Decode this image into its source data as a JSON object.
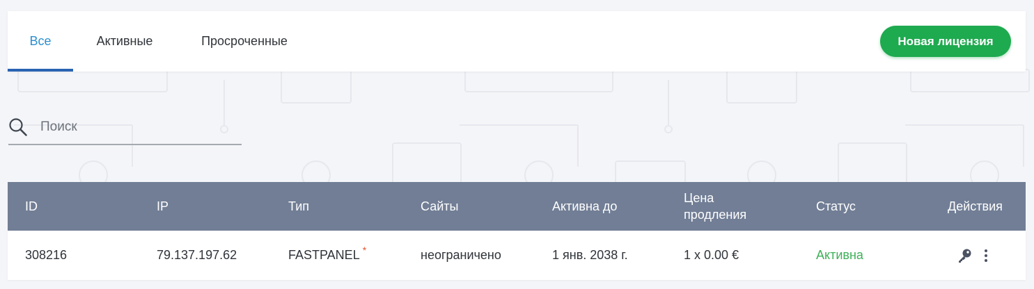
{
  "tabs": [
    {
      "label": "Все",
      "active": true
    },
    {
      "label": "Активные",
      "active": false
    },
    {
      "label": "Просроченные",
      "active": false
    }
  ],
  "new_license_button": "Новая лицензия",
  "search": {
    "placeholder": "Поиск",
    "value": ""
  },
  "table": {
    "headers": {
      "id": "ID",
      "ip": "IP",
      "type": "Тип",
      "sites": "Сайты",
      "active_until": "Активна до",
      "renewal_price_line1": "Цена",
      "renewal_price_line2": "продления",
      "status": "Статус",
      "actions": "Действия"
    },
    "rows": [
      {
        "id": "308216",
        "ip": "79.137.197.62",
        "type": "FASTPANEL",
        "type_mark": "*",
        "sites": "неограничено",
        "active_until": "1 янв. 2038 г.",
        "renewal_price": "1 x 0.00 €",
        "status": "Активна",
        "actions": [
          "key-icon",
          "more-vertical-icon"
        ]
      }
    ]
  },
  "colors": {
    "accent_tab": "#2a8fd0",
    "tab_underline": "#2a63b3",
    "primary_button": "#1eaa4f",
    "table_header": "#717e95",
    "status_active": "#3eb058",
    "asterisk": "#e2542f"
  }
}
